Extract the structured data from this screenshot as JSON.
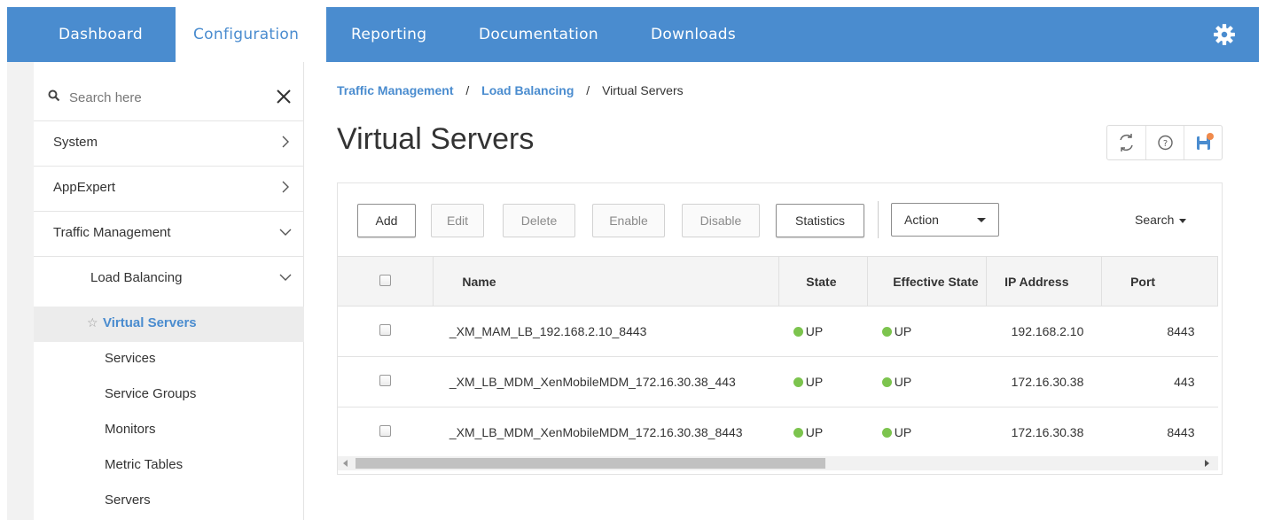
{
  "nav": {
    "items": [
      {
        "label": "Dashboard"
      },
      {
        "label": "Configuration"
      },
      {
        "label": "Reporting"
      },
      {
        "label": "Documentation"
      },
      {
        "label": "Downloads"
      }
    ],
    "active": "Configuration",
    "settings_icon": "gear-icon",
    "bar_color": "#4a8ccf"
  },
  "sidebar": {
    "search": {
      "placeholder": "Search here",
      "value": ""
    },
    "items": [
      {
        "label": "System",
        "icon": "chevron-right-icon"
      },
      {
        "label": "AppExpert",
        "icon": "chevron-right-icon"
      },
      {
        "label": "Traffic Management",
        "icon": "chevron-down-icon"
      },
      {
        "label": "Load Balancing",
        "icon": "chevron-down-icon"
      }
    ],
    "sub_items": [
      {
        "label": "Virtual Servers",
        "active": true,
        "favorite_icon": "star-icon"
      },
      {
        "label": "Services"
      },
      {
        "label": "Service Groups"
      },
      {
        "label": "Monitors"
      },
      {
        "label": "Metric Tables"
      },
      {
        "label": "Servers"
      }
    ]
  },
  "breadcrumb": {
    "items": [
      "Traffic Management",
      "Load Balancing",
      "Virtual Servers"
    ],
    "separator": "/"
  },
  "page": {
    "title": "Virtual Servers",
    "tools": [
      "refresh-icon",
      "help-icon",
      "save-icon"
    ]
  },
  "toolbar": {
    "add": "Add",
    "edit": "Edit",
    "delete": "Delete",
    "enable": "Enable",
    "disable": "Disable",
    "statistics": "Statistics",
    "action": "Action",
    "search": "Search"
  },
  "table": {
    "columns": [
      "Name",
      "State",
      "Effective State",
      "IP Address",
      "Port"
    ],
    "rows": [
      {
        "name": "_XM_MAM_LB_192.168.2.10_8443",
        "state": "UP",
        "effective_state": "UP",
        "ip": "192.168.2.10",
        "port": "8443"
      },
      {
        "name": "_XM_LB_MDM_XenMobileMDM_172.16.30.38_443",
        "state": "UP",
        "effective_state": "UP",
        "ip": "172.16.30.38",
        "port": "443"
      },
      {
        "name": "_XM_LB_MDM_XenMobileMDM_172.16.30.38_8443",
        "state": "UP",
        "effective_state": "UP",
        "ip": "172.16.30.38",
        "port": "8443"
      }
    ],
    "status_color": "#7cc44e"
  }
}
